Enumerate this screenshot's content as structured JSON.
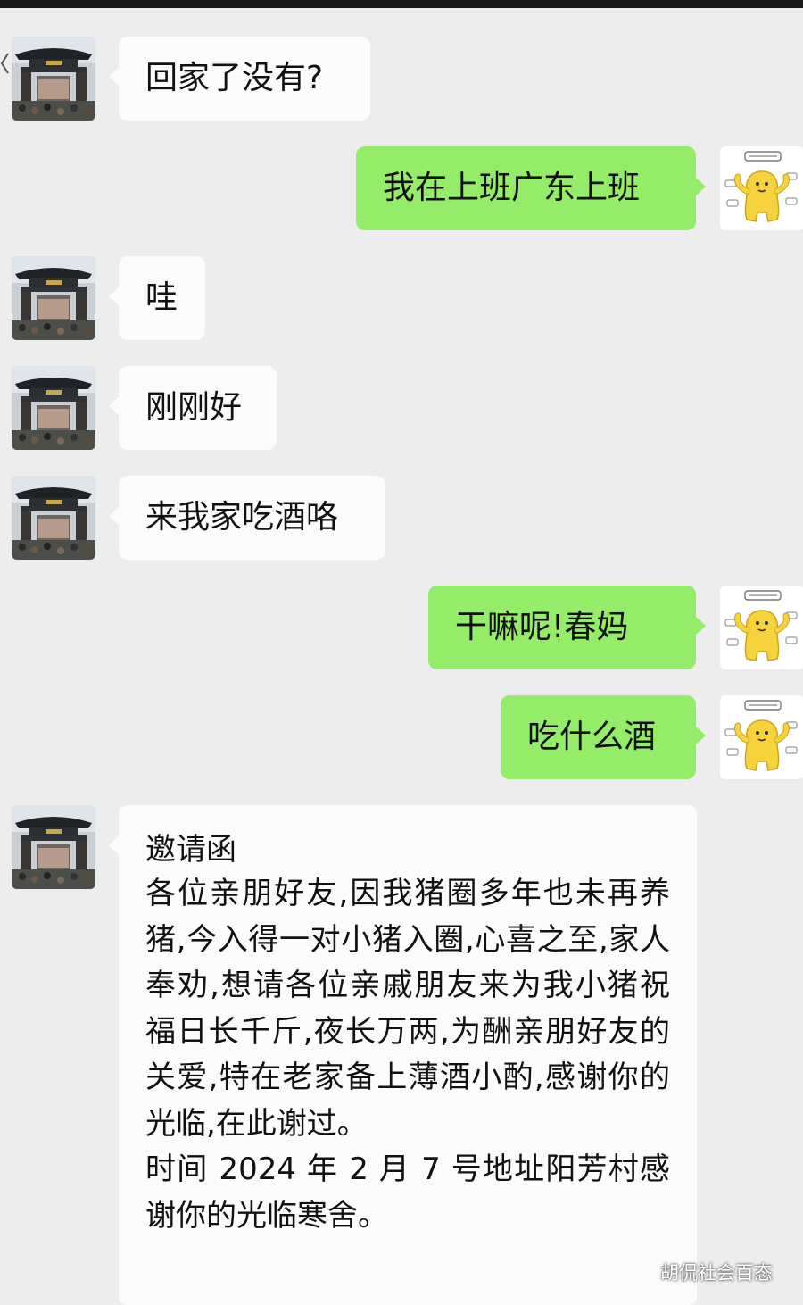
{
  "messages": [
    {
      "from": "contact",
      "text": "回家了没有?"
    },
    {
      "from": "me",
      "text": "我在上班广东上班"
    },
    {
      "from": "contact",
      "text": "哇"
    },
    {
      "from": "contact",
      "text": "刚刚好"
    },
    {
      "from": "contact",
      "text": "来我家吃酒咯"
    },
    {
      "from": "me",
      "text": "干嘛呢!春妈"
    },
    {
      "from": "me",
      "text": "吃什么酒"
    }
  ],
  "invitation": {
    "title": "邀请函",
    "body": "各位亲朋好友,因我猪圈多年也未再养猪,今入得一对小猪入圈,心喜之至,家人奉劝,想请各位亲戚朋友来为我小猪祝福日长千斤,夜长万两,为酬亲朋好友的关爱,特在老家备上薄酒小酌,感谢你的光临,在此谢过。\n时间 2024 年 2 月 7 号地址阳芳村感谢你的光临寒舍。"
  },
  "watermark": "胡侃社会百态",
  "colors": {
    "outgoing_bubble": "#95ec69",
    "incoming_bubble": "#fbfbfb",
    "background": "#ededed"
  },
  "avatars": {
    "contact": "gate-photo-avatar",
    "me": "yellow-cartoon-avatar"
  }
}
